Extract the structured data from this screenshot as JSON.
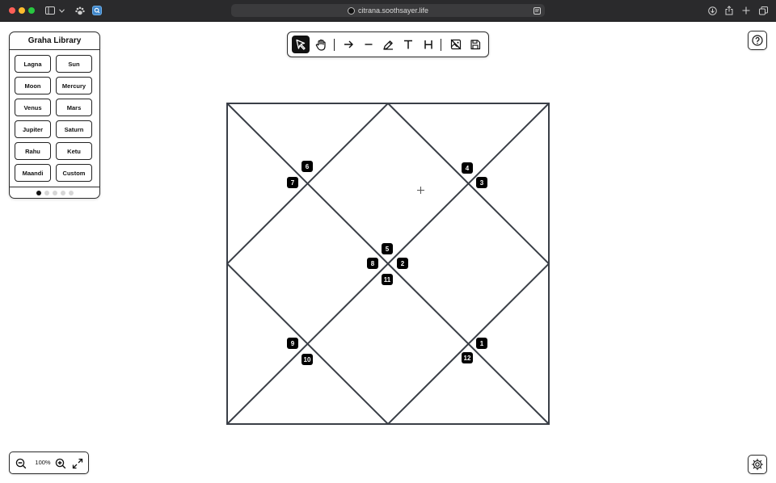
{
  "browser": {
    "url": "citrana.soothsayer.life"
  },
  "library": {
    "title": "Graha Library",
    "items": [
      "Lagna",
      "Sun",
      "Moon",
      "Mercury",
      "Venus",
      "Mars",
      "Jupiter",
      "Saturn",
      "Rahu",
      "Ketu",
      "Maandi",
      "Custom"
    ],
    "page_count": 5,
    "active_page": 1
  },
  "toolbar": {
    "tools": [
      {
        "name": "select-tool",
        "icon": "pointer-icon",
        "active": true
      },
      {
        "name": "hand-tool",
        "icon": "hand-icon",
        "active": false
      },
      {
        "name": "arrow-tool",
        "icon": "arrow-right-icon",
        "active": false
      },
      {
        "name": "line-tool",
        "icon": "line-icon",
        "active": false
      },
      {
        "name": "pen-tool",
        "icon": "pen-icon",
        "active": false
      },
      {
        "name": "text-tool",
        "icon": "text-icon",
        "active": false
      },
      {
        "name": "heading-tool",
        "icon": "heading-icon",
        "active": false
      },
      {
        "name": "hide-image-tool",
        "icon": "image-off-icon",
        "active": false
      },
      {
        "name": "save-tool",
        "icon": "save-icon",
        "active": false
      }
    ]
  },
  "zoom": {
    "level": "100%"
  },
  "chart": {
    "houses": [
      {
        "number": "1"
      },
      {
        "number": "2"
      },
      {
        "number": "3"
      },
      {
        "number": "4"
      },
      {
        "number": "5"
      },
      {
        "number": "6"
      },
      {
        "number": "7"
      },
      {
        "number": "8"
      },
      {
        "number": "9"
      },
      {
        "number": "10"
      },
      {
        "number": "11"
      },
      {
        "number": "12"
      }
    ]
  },
  "colors": {
    "chart_line": "#3a3f47",
    "label_bg": "#000000",
    "active_tool_bg": "#111111"
  }
}
